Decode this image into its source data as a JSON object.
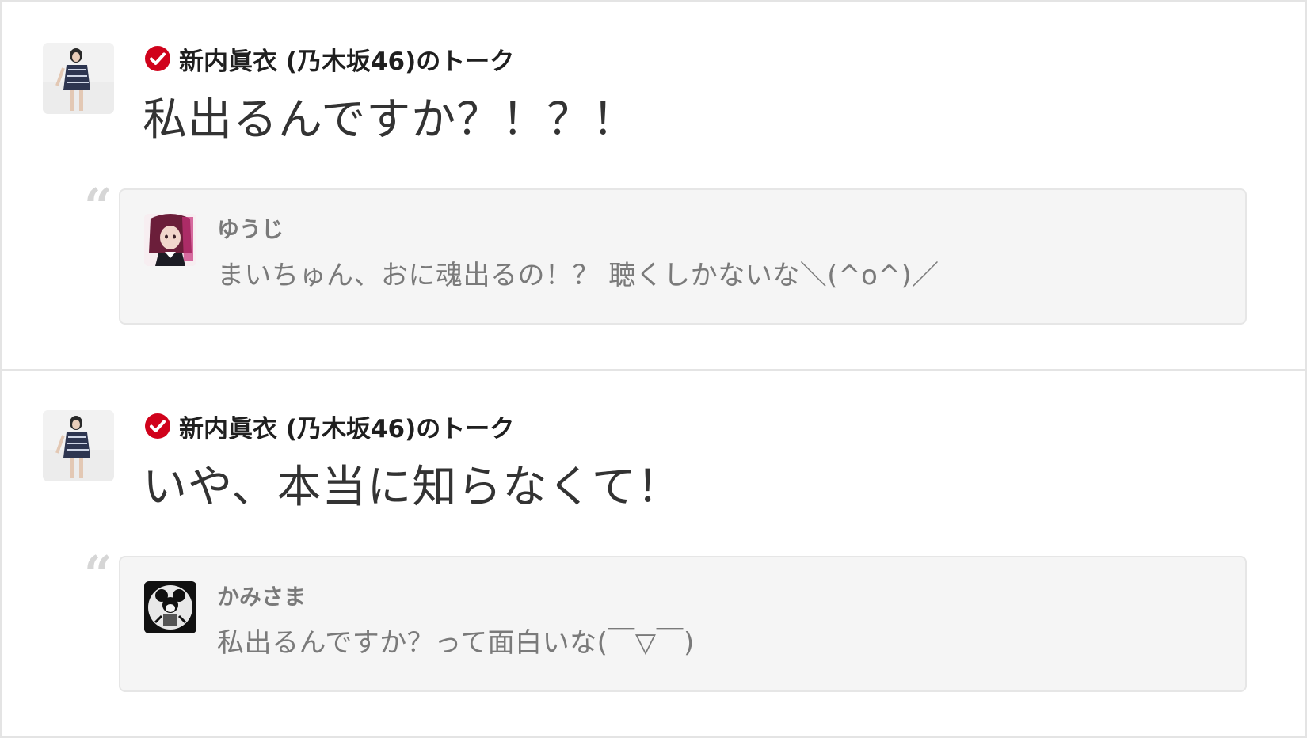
{
  "talks": [
    {
      "author": "新内眞衣 (乃木坂46)のトーク",
      "message": "私出るんですか？！？！",
      "reply": {
        "user": "ゆうじ",
        "text": "まいちゅん、おに魂出るの！？ 聴くしかないな＼(^o^)／"
      }
    },
    {
      "author": "新内眞衣 (乃木坂46)のトーク",
      "message": "いや、本当に知らなくて！",
      "reply": {
        "user": "かみさま",
        "text": "私出るんですか？って面白いな(￣▽￣)"
      }
    }
  ],
  "icons": {
    "verified": "verified-check-icon",
    "quote": "quote-icon"
  },
  "colors": {
    "verified_badge": "#d0021b",
    "quote_mark": "#d6d6d6",
    "reply_background": "#f5f5f5",
    "reply_text": "#7a7a7a",
    "divider": "#e4e4e4"
  }
}
